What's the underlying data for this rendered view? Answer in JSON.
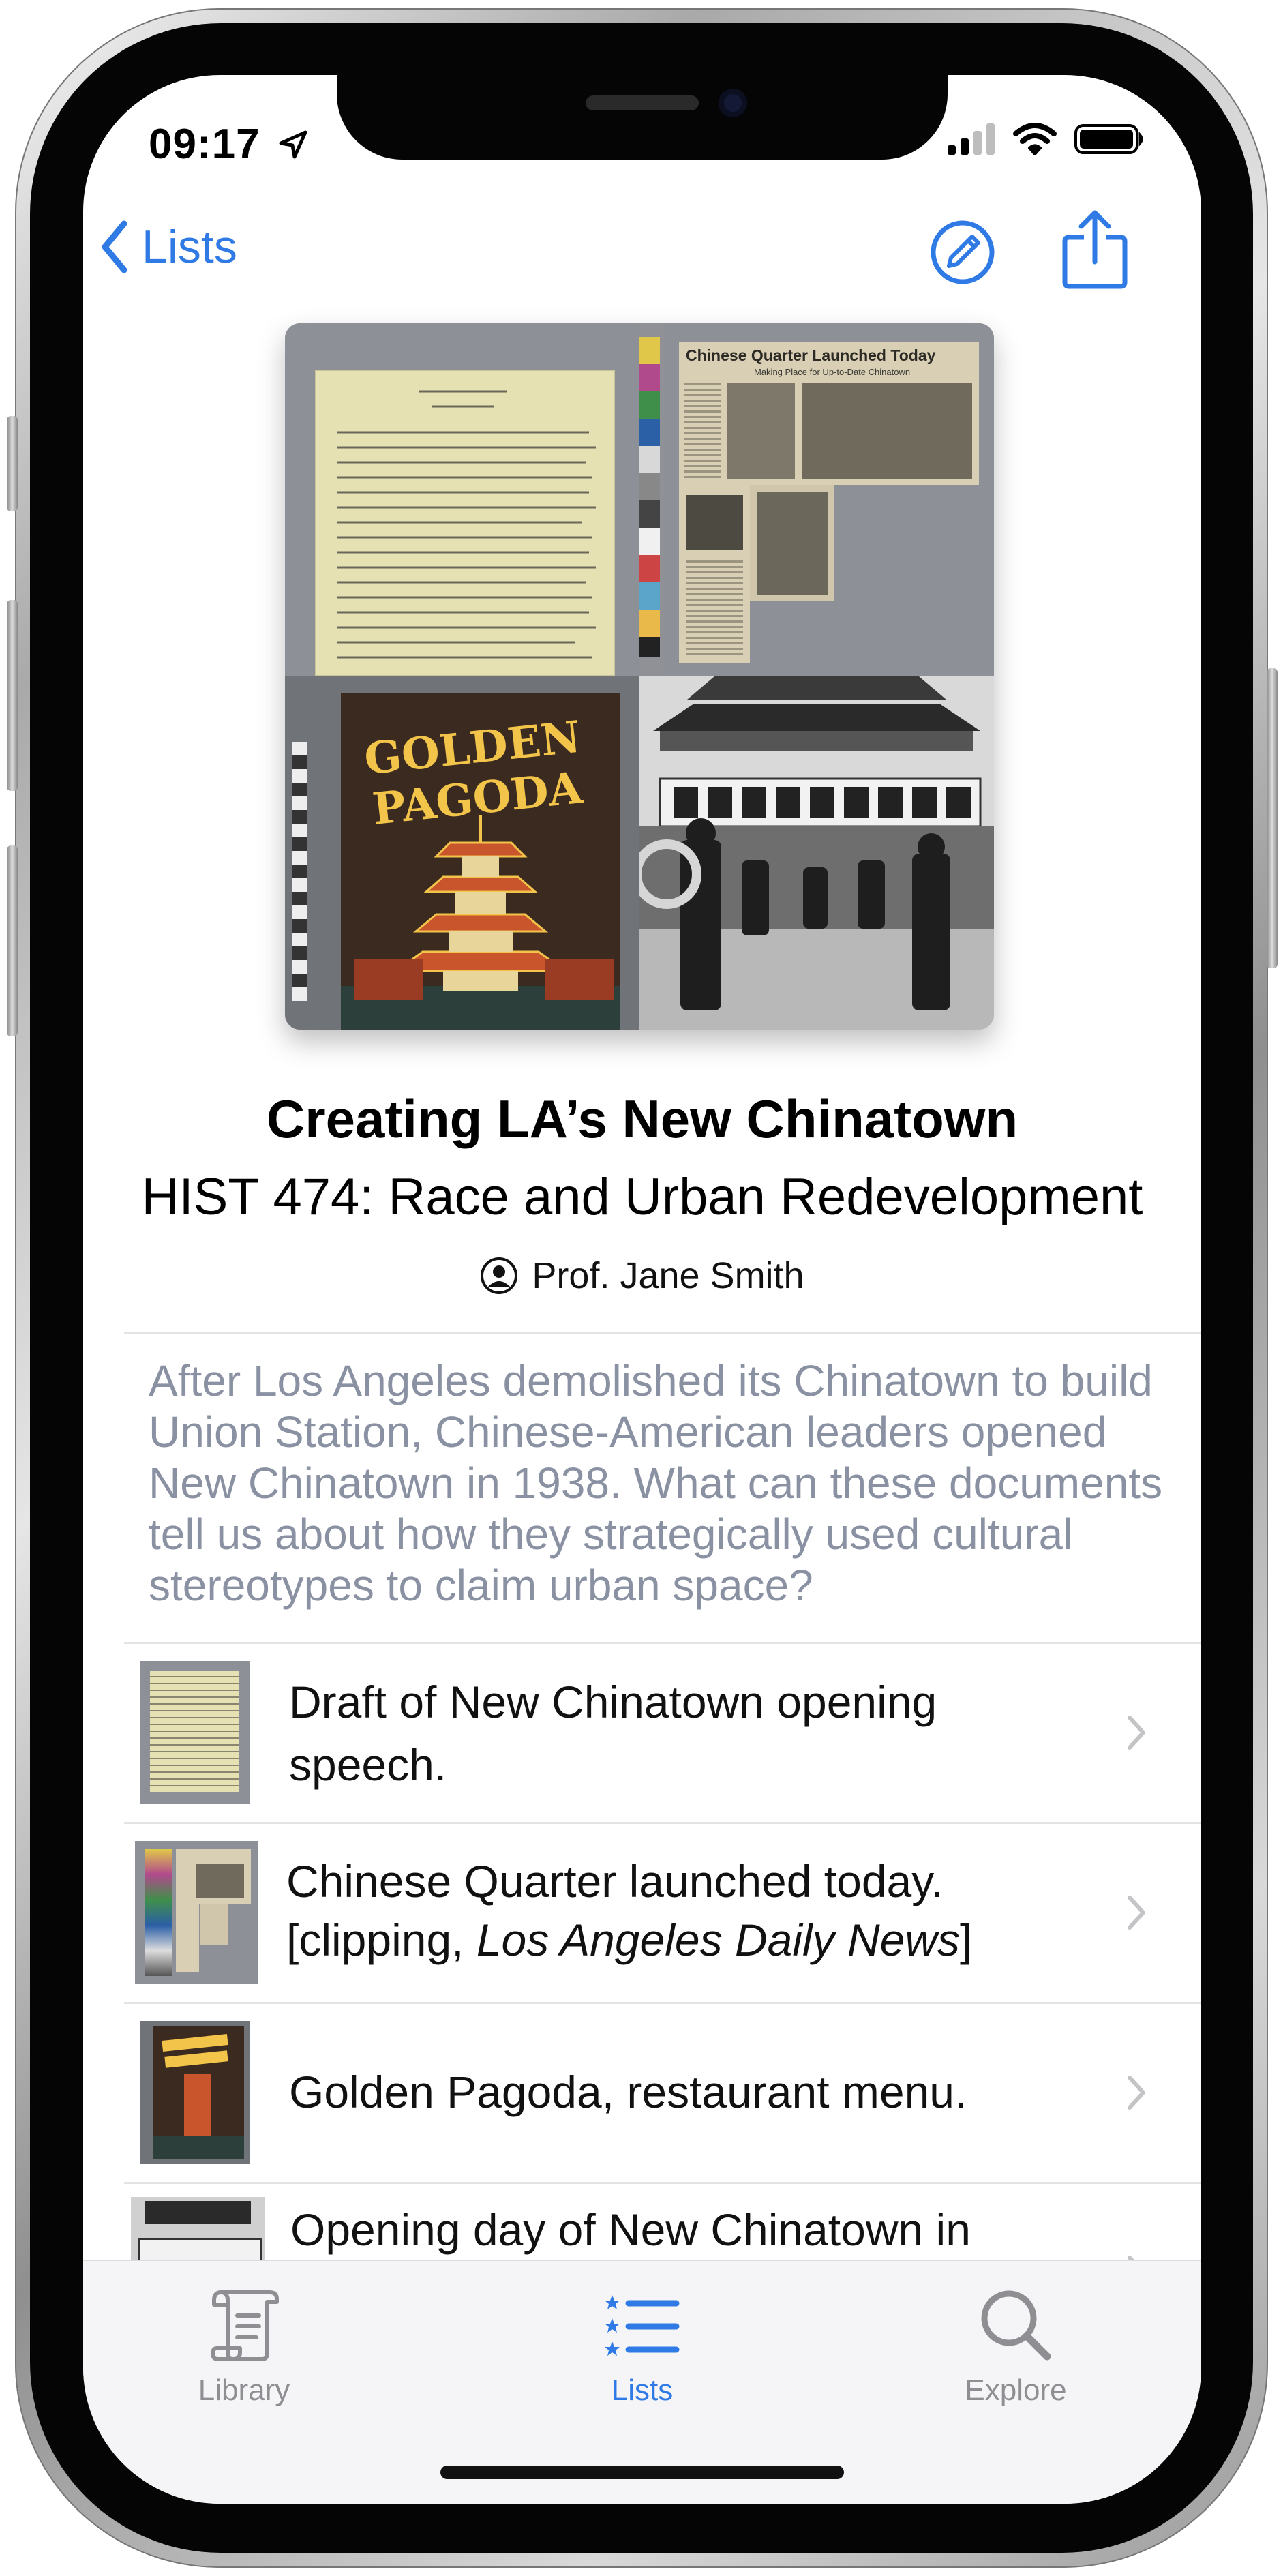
{
  "status_bar": {
    "time": "09:17"
  },
  "nav": {
    "back_label": "Lists"
  },
  "cover": {
    "clipping_headline": "Chinese Quarter Launched Today",
    "clipping_subhead": "Making Place for Up-to-Date Chinatown",
    "menu_title_1": "GOLDEN",
    "menu_title_2": "PAGODA"
  },
  "list_header": {
    "title": "Creating LA’s New Chinatown",
    "subtitle": "HIST 474: Race and Urban Redevelopment",
    "author": "Prof. Jane Smith",
    "description": "After Los Angeles demolished its Chinatown to build Union Station, Chinese-American leaders opened New Chinatown in 1938. What can these documents tell us about how they strategically used cultural stereotypes to claim urban space?"
  },
  "items": [
    {
      "line1": "Draft of New Chinatown opening",
      "line2": "speech."
    },
    {
      "line1": "Chinese Quarter launched today.",
      "line2_prefix": "[clipping, ",
      "line2_italic": "Los Angeles Daily News",
      "line2_suffix": "]"
    },
    {
      "line1": "Golden Pagoda, restaurant menu."
    },
    {
      "line1": "Opening day of New Chinatown in"
    }
  ],
  "tabbar": {
    "tabs": [
      {
        "label": "Library",
        "icon": "scroll-icon",
        "active": false
      },
      {
        "label": "Lists",
        "icon": "list-icon",
        "active": true
      },
      {
        "label": "Explore",
        "icon": "magnifier-icon",
        "active": false
      }
    ]
  },
  "colors": {
    "accent": "#2f7ae5",
    "inactive": "#8e8e93",
    "description": "#8a91a2"
  }
}
